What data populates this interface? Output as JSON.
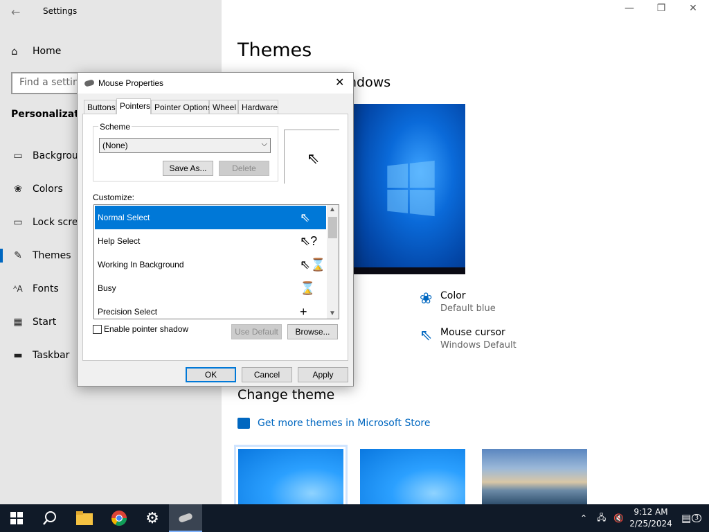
{
  "settings": {
    "title": "Settings",
    "home_label": "Home",
    "search_placeholder": "Find a setting",
    "section_title": "Personalization",
    "nav": [
      {
        "label": "Background",
        "icon": "image-icon"
      },
      {
        "label": "Colors",
        "icon": "palette-icon"
      },
      {
        "label": "Lock screen",
        "icon": "monitor-icon"
      },
      {
        "label": "Themes",
        "icon": "brush-icon"
      },
      {
        "label": "Fonts",
        "icon": "font-icon"
      },
      {
        "label": "Start",
        "icon": "start-grid-icon"
      },
      {
        "label": "Taskbar",
        "icon": "taskbar-icon"
      }
    ],
    "selected_nav": "Themes"
  },
  "themes": {
    "page_title": "Themes",
    "subheading": "ndows",
    "options": [
      {
        "title": "Color",
        "value": "Default blue",
        "icon": "palette-icon"
      },
      {
        "title": "Mouse cursor",
        "value": "Windows Default",
        "icon": "cursor-icon"
      }
    ],
    "change_theme": "Change theme",
    "store_link": "Get more themes in Microsoft Store"
  },
  "dialog": {
    "title": "Mouse Properties",
    "tabs": [
      "Buttons",
      "Pointers",
      "Pointer Options",
      "Wheel",
      "Hardware"
    ],
    "active_tab": "Pointers",
    "scheme_label": "Scheme",
    "scheme_value": "(None)",
    "save_as": "Save As...",
    "delete": "Delete",
    "customize_label": "Customize:",
    "pointers": [
      {
        "label": "Normal Select",
        "cursor": "⇖"
      },
      {
        "label": "Help Select",
        "cursor": "⇖?"
      },
      {
        "label": "Working In Background",
        "cursor": "⇖⌛"
      },
      {
        "label": "Busy",
        "cursor": "⌛"
      },
      {
        "label": "Precision Select",
        "cursor": "+"
      }
    ],
    "selected_pointer": "Normal Select",
    "enable_shadow": "Enable pointer shadow",
    "use_default": "Use Default",
    "browse": "Browse...",
    "ok": "OK",
    "cancel": "Cancel",
    "apply": "Apply"
  },
  "taskbar": {
    "time": "9:12 AM",
    "date": "2/25/2024",
    "notification_count": "3"
  },
  "colors": {
    "accent": "#0067c0",
    "selection": "#0078d7",
    "taskbar": "#101a28"
  }
}
